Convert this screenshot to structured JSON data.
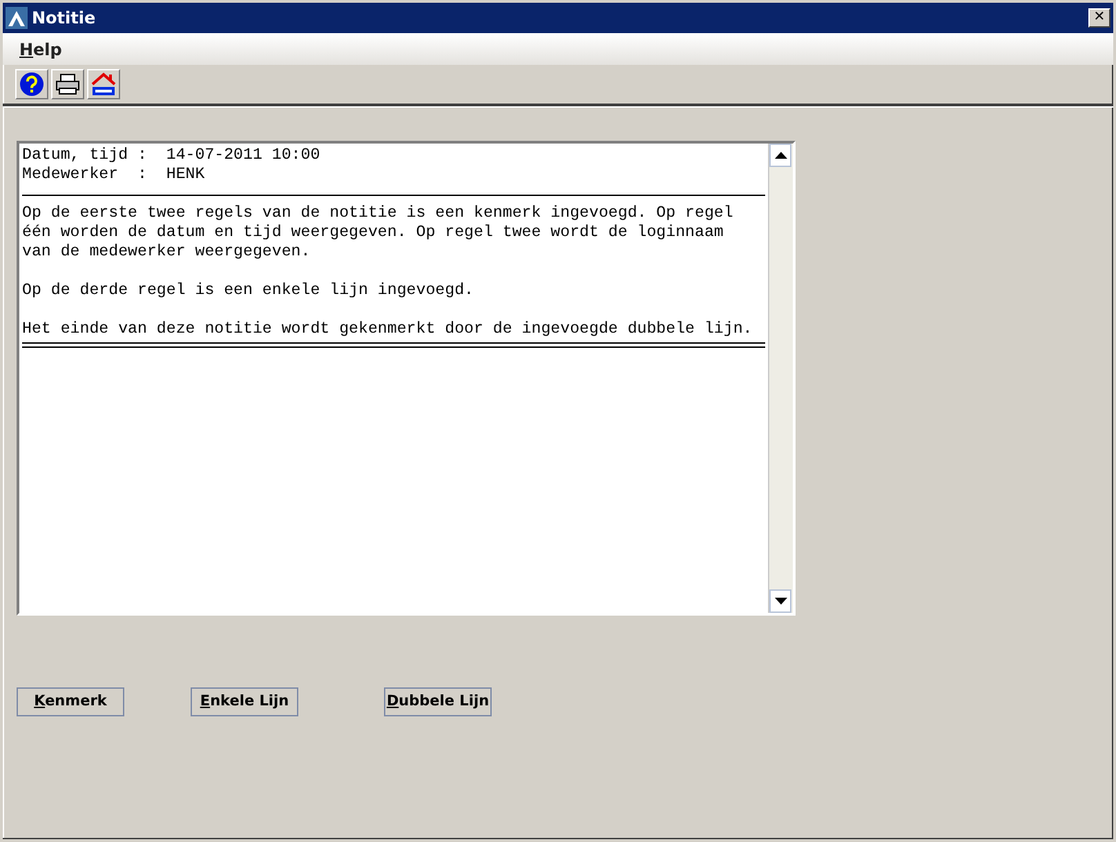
{
  "window": {
    "title": "Notitie",
    "close": "✕"
  },
  "menu": [
    {
      "label": "Help"
    }
  ],
  "toolbar": [
    {
      "kind": "help"
    },
    {
      "kind": "print"
    },
    {
      "kind": "logo"
    }
  ],
  "note": {
    "lines": [
      {
        "kind": "text",
        "text": "Datum, tijd :  14-07-2011 10:00"
      },
      {
        "kind": "text",
        "text": "Medewerker  :  HENK"
      },
      {
        "kind": "single_rule"
      },
      {
        "kind": "text",
        "text": "Op de eerste twee regels van de notitie is een kenmerk ingevoegd. Op regel"
      },
      {
        "kind": "text",
        "text": "één worden de datum en tijd weergegeven. Op regel twee wordt de loginnaam"
      },
      {
        "kind": "text",
        "text": "van de medewerker weergegeven."
      },
      {
        "kind": "blank"
      },
      {
        "kind": "text",
        "text": "Op de derde regel is een enkele lijn ingevoegd."
      },
      {
        "kind": "blank"
      },
      {
        "kind": "text",
        "text": "Het einde van deze notitie wordt gekenmerkt door de ingevoegde dubbele lijn."
      },
      {
        "kind": "double_rule"
      }
    ]
  },
  "buttons": [
    {
      "label": "Kenmerk"
    },
    {
      "label": "Enkele Lijn"
    },
    {
      "label": "Dubbele Lijn"
    }
  ]
}
